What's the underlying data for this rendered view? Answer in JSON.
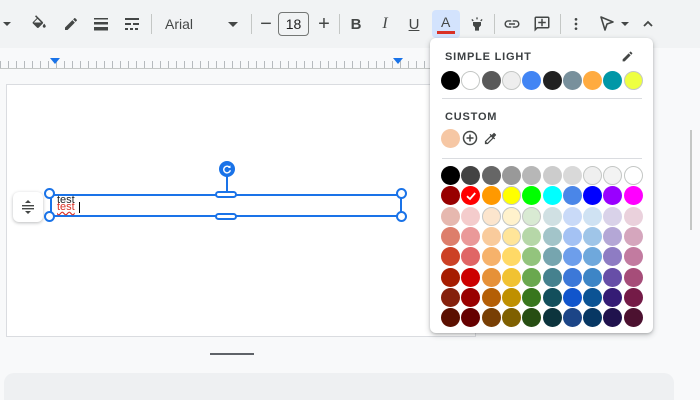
{
  "toolbar": {
    "font_name": "Arial",
    "font_size": "18",
    "decrease_label": "−",
    "increase_label": "+",
    "bold_label": "B",
    "italic_label": "I",
    "underline_label": "U",
    "text_color_label": "A",
    "text_color_accent": "#d93025",
    "icons": [
      "chevron-down-icon",
      "paint-bucket-icon",
      "pen-icon",
      "border-weight-icon",
      "border-dash-icon",
      "dropdown-caret-icon",
      "minus-icon",
      "plus-icon",
      "bold-icon",
      "italic-icon",
      "underline-icon",
      "text-color-icon",
      "highlighter-icon",
      "link-icon",
      "comment-icon",
      "more-vert-icon",
      "select-pointer-icon",
      "chevron-up-icon"
    ]
  },
  "textbox": {
    "line1": "test",
    "line2": "test"
  },
  "color_picker": {
    "simple_light_title": "SIMPLE LIGHT",
    "custom_title": "CUSTOM",
    "theme_colors": [
      "#000000",
      "#ffffff",
      "#595959",
      "#eeeeee",
      "#4285f4",
      "#212121",
      "#78909c",
      "#ffab40",
      "#0097a7",
      "#eeff41"
    ],
    "custom_colors": [
      "#f6c7a4"
    ],
    "selected_color": "#ff0000",
    "grid": [
      [
        "#000000",
        "#434343",
        "#666666",
        "#999999",
        "#b7b7b7",
        "#cccccc",
        "#d9d9d9",
        "#efefef",
        "#f3f3f3",
        "#ffffff"
      ],
      [
        "#980000",
        "#ff0000",
        "#ff9900",
        "#ffff00",
        "#00ff00",
        "#00ffff",
        "#4a86e8",
        "#0000ff",
        "#9900ff",
        "#ff00ff"
      ],
      [
        "#e6b8af",
        "#f4cccc",
        "#fce5cd",
        "#fff2cc",
        "#d9ead3",
        "#d0e0e3",
        "#c9daf8",
        "#cfe2f3",
        "#d9d2e9",
        "#ead1dc"
      ],
      [
        "#dd7e6b",
        "#ea9999",
        "#f9cb9c",
        "#ffe599",
        "#b6d7a8",
        "#a2c4c9",
        "#a4c2f4",
        "#9fc5e8",
        "#b4a7d6",
        "#d5a6bd"
      ],
      [
        "#cc4125",
        "#e06666",
        "#f6b26b",
        "#ffd966",
        "#93c47d",
        "#76a5af",
        "#6d9eeb",
        "#6fa8dc",
        "#8e7cc3",
        "#c27ba0"
      ],
      [
        "#a61c00",
        "#cc0000",
        "#e69138",
        "#f1c232",
        "#6aa84f",
        "#45818e",
        "#3c78d8",
        "#3d85c6",
        "#674ea7",
        "#a64d79"
      ],
      [
        "#85200c",
        "#990000",
        "#b45f06",
        "#bf9000",
        "#38761d",
        "#134f5c",
        "#1155cc",
        "#0b5394",
        "#351c75",
        "#741b47"
      ],
      [
        "#5b0f00",
        "#660000",
        "#783f04",
        "#7f6000",
        "#274e13",
        "#0c343d",
        "#1c4587",
        "#073763",
        "#20124d",
        "#4c1130"
      ]
    ]
  }
}
